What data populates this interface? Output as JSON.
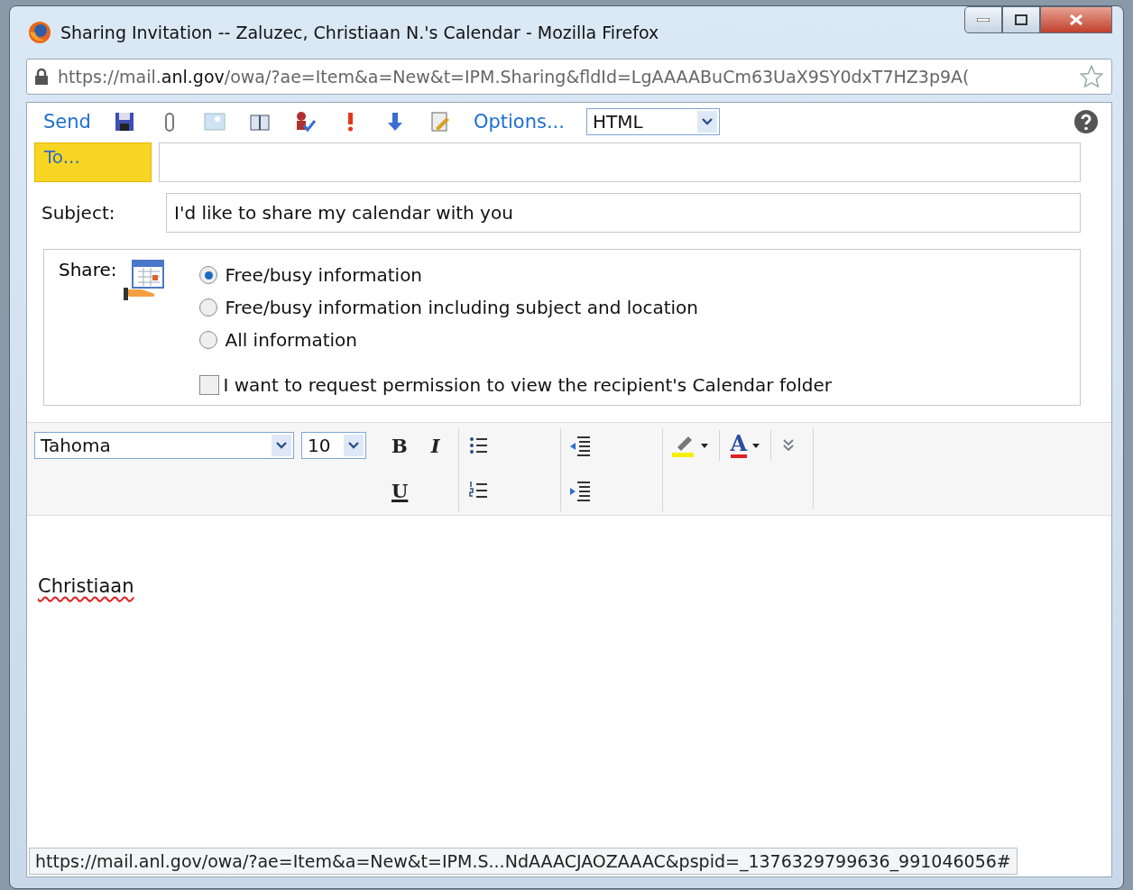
{
  "window": {
    "title": "Sharing Invitation -- Zaluzec, Christiaan N.'s Calendar - Mozilla Firefox"
  },
  "address_bar": {
    "url": "https://mail.**anl.gov**/owa/?ae=Item&a=New&t=IPM.Sharing&fldId=LgAAAABuCm63UaX9SY0dxT7HZ3p9A("
  },
  "toolbar": {
    "send": "Send",
    "options": "Options...",
    "format": "HTML"
  },
  "to_button": "To...",
  "subject": {
    "label": "Subject:",
    "value": "I'd like to share my calendar with you"
  },
  "share": {
    "label": "Share:",
    "options": [
      {
        "label": "Free/busy information",
        "selected": true
      },
      {
        "label": "Free/busy information including subject and location",
        "selected": false
      },
      {
        "label": "All information",
        "selected": false
      }
    ],
    "permission": {
      "label": "I want to request permission to view the recipient's Calendar folder",
      "checked": false
    }
  },
  "format_toolbar": {
    "font": "Tahoma",
    "size": "10",
    "bold": "B",
    "italic": "I",
    "underline": "U",
    "font_color": "A"
  },
  "body": {
    "text": "Christiaan"
  },
  "status_url": "https://mail.anl.gov/owa/?ae=Item&a=New&t=IPM.S...NdAAACJAOZAAAC&pspid=_1376329799636_991046056#"
}
